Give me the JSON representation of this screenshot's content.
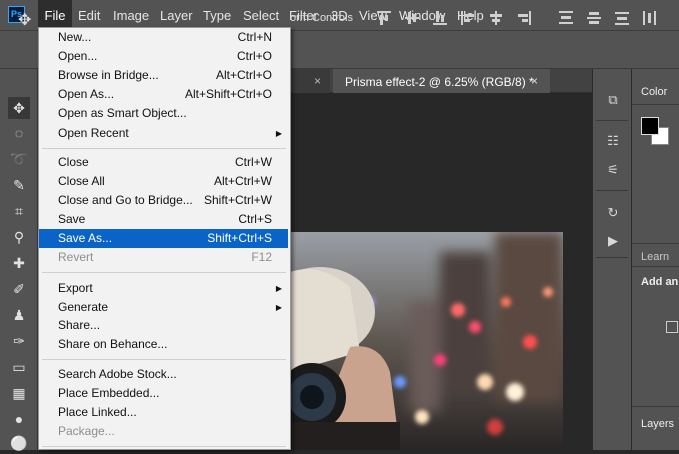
{
  "app_logo": "Ps",
  "menubar": {
    "items": [
      "File",
      "Edit",
      "Image",
      "Layer",
      "Type",
      "Select",
      "Filter",
      "3D",
      "View",
      "Window",
      "Help"
    ]
  },
  "options_bar": {
    "move_icon": "move-icon",
    "partial_label": "orm Controls"
  },
  "tabs": {
    "tab1_close": "×",
    "tab2_label": "Prisma effect-2 @ 6.25% (RGB/8) *",
    "tab2_close": "×"
  },
  "file_menu": {
    "items": [
      {
        "label": "New...",
        "shortcut": "Ctrl+N"
      },
      {
        "label": "Open...",
        "shortcut": "Ctrl+O"
      },
      {
        "label": "Browse in Bridge...",
        "shortcut": "Alt+Ctrl+O"
      },
      {
        "label": "Open As...",
        "shortcut": "Alt+Shift+Ctrl+O"
      },
      {
        "label": "Open as Smart Object...",
        "shortcut": ""
      },
      {
        "label": "Open Recent",
        "shortcut": "",
        "submenu": true
      },
      {
        "label": "Close",
        "shortcut": "Ctrl+W"
      },
      {
        "label": "Close All",
        "shortcut": "Alt+Ctrl+W"
      },
      {
        "label": "Close and Go to Bridge...",
        "shortcut": "Shift+Ctrl+W"
      },
      {
        "label": "Save",
        "shortcut": "Ctrl+S"
      },
      {
        "label": "Save As...",
        "shortcut": "Shift+Ctrl+S",
        "selected": true
      },
      {
        "label": "Revert",
        "shortcut": "F12",
        "disabled": true
      },
      {
        "label": "Export",
        "shortcut": "",
        "submenu": true
      },
      {
        "label": "Generate",
        "shortcut": "",
        "submenu": true
      },
      {
        "label": "Share...",
        "shortcut": ""
      },
      {
        "label": "Share on Behance...",
        "shortcut": ""
      },
      {
        "label": "Search Adobe Stock...",
        "shortcut": ""
      },
      {
        "label": "Place Embedded...",
        "shortcut": ""
      },
      {
        "label": "Place Linked...",
        "shortcut": ""
      },
      {
        "label": "Package...",
        "shortcut": "",
        "disabled": true
      }
    ]
  },
  "panels": {
    "color_label": "Color",
    "learn_label": "Learn",
    "add_label": "Add an",
    "layers_label": "Layers"
  },
  "colors": {
    "menu_highlight": "#0a64c8",
    "ui_gray": "#535353",
    "canvas_bg": "#282828"
  }
}
